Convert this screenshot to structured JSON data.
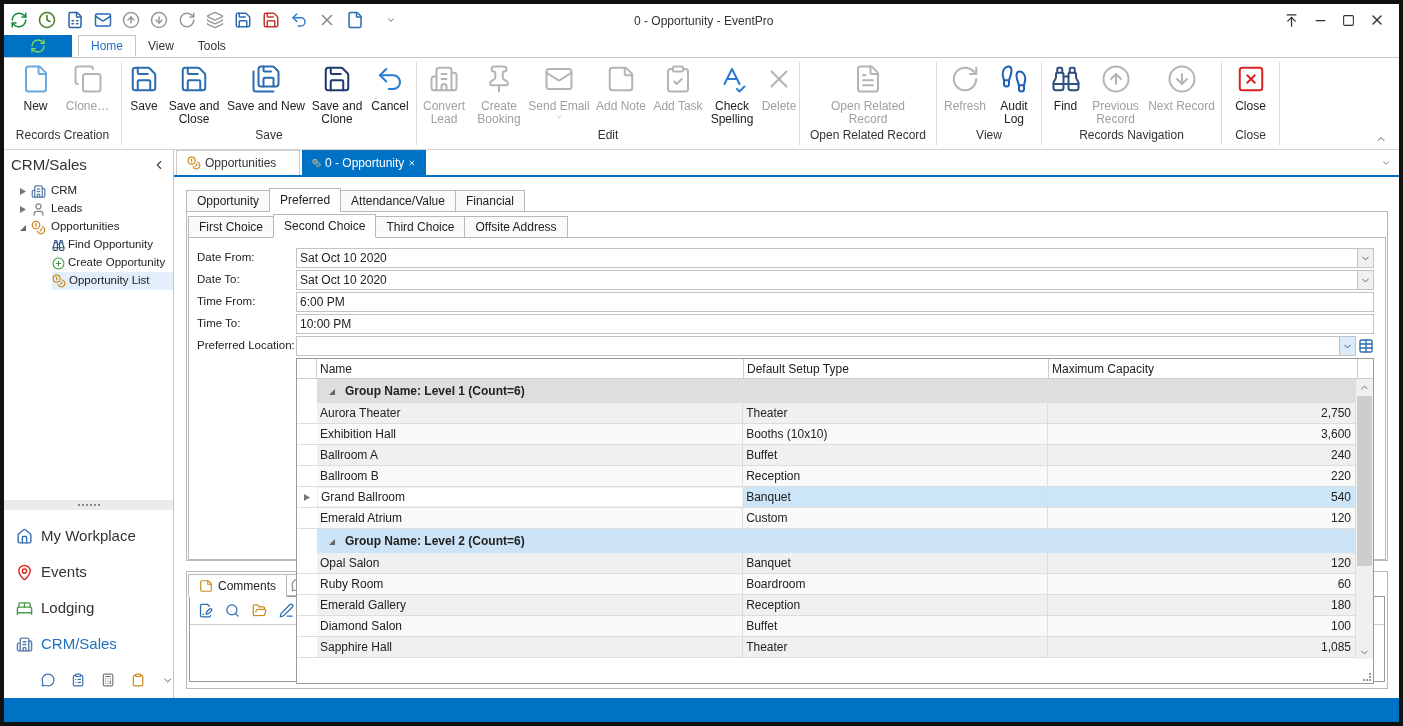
{
  "window": {
    "title": "0 - Opportunity - EventPro"
  },
  "ribbon_tabs": [
    {
      "label": "Home",
      "selected": true
    },
    {
      "label": "View",
      "selected": false
    },
    {
      "label": "Tools",
      "selected": false
    }
  ],
  "ribbon_groups": [
    {
      "label": "Records Creation",
      "buttons": [
        {
          "label": "New",
          "disabled": false,
          "dropdown": false
        },
        {
          "label": "Clone…",
          "disabled": true,
          "dropdown": false
        }
      ]
    },
    {
      "label": "Save",
      "buttons": [
        {
          "label": "Save",
          "disabled": false,
          "dropdown": false
        },
        {
          "label": "Save and Close",
          "disabled": false,
          "dropdown": false
        },
        {
          "label": "Save and New",
          "disabled": false,
          "dropdown": false
        },
        {
          "label": "Save and Clone",
          "disabled": false,
          "dropdown": false
        },
        {
          "label": "Cancel",
          "disabled": false,
          "dropdown": false
        }
      ]
    },
    {
      "label": "Edit",
      "buttons": [
        {
          "label": "Convert Lead",
          "disabled": true,
          "dropdown": false
        },
        {
          "label": "Create Booking",
          "disabled": true,
          "dropdown": false
        },
        {
          "label": "Send Email",
          "disabled": true,
          "dropdown": true
        },
        {
          "label": "Add Note",
          "disabled": true,
          "dropdown": false
        },
        {
          "label": "Add Task",
          "disabled": true,
          "dropdown": false
        },
        {
          "label": "Check Spelling",
          "disabled": false,
          "dropdown": false
        },
        {
          "label": "Delete",
          "disabled": true,
          "dropdown": false
        }
      ]
    },
    {
      "label": "Open Related Record",
      "buttons": [
        {
          "label": "Open Related Record",
          "disabled": true,
          "dropdown": false
        }
      ]
    },
    {
      "label": "View",
      "buttons": [
        {
          "label": "Refresh",
          "disabled": true,
          "dropdown": false
        },
        {
          "label": "Audit Log",
          "disabled": false,
          "dropdown": false
        }
      ]
    },
    {
      "label": "Records Navigation",
      "buttons": [
        {
          "label": "Find",
          "disabled": false,
          "dropdown": false
        },
        {
          "label": "Previous Record",
          "disabled": true,
          "dropdown": false
        },
        {
          "label": "Next Record",
          "disabled": true,
          "dropdown": false
        }
      ]
    },
    {
      "label": "Close",
      "buttons": [
        {
          "label": "Close",
          "disabled": false,
          "dropdown": false
        }
      ]
    }
  ],
  "sidebar": {
    "title": "CRM/Sales",
    "tree": [
      {
        "label": "CRM",
        "expanded": false,
        "selected": false
      },
      {
        "label": "Leads",
        "expanded": false,
        "selected": false
      },
      {
        "label": "Opportunities",
        "expanded": true,
        "selected": false,
        "children": [
          {
            "label": "Find Opportunity",
            "selected": false
          },
          {
            "label": "Create Opportunity",
            "selected": false
          },
          {
            "label": "Opportunity List",
            "selected": true
          }
        ]
      }
    ],
    "nav": [
      {
        "label": "My Workplace",
        "selected": false
      },
      {
        "label": "Events",
        "selected": false
      },
      {
        "label": "Lodging",
        "selected": false
      },
      {
        "label": "CRM/Sales",
        "selected": true
      }
    ]
  },
  "doc_tabs": [
    {
      "label": "Opportunities",
      "selected": false
    },
    {
      "label": "0 - Opportunity",
      "selected": true
    }
  ],
  "form_tabs": [
    {
      "label": "Opportunity",
      "selected": false
    },
    {
      "label": "Preferred",
      "selected": true
    },
    {
      "label": "Attendance/Value",
      "selected": false
    },
    {
      "label": "Financial",
      "selected": false
    }
  ],
  "sub_tabs": [
    {
      "label": "First Choice",
      "selected": false
    },
    {
      "label": "Second Choice",
      "selected": true
    },
    {
      "label": "Third Choice",
      "selected": false
    },
    {
      "label": "Offsite Address",
      "selected": false
    }
  ],
  "fields": [
    {
      "label": "Date From:",
      "value": "Sat Oct 10 2020",
      "kind": "dropdown"
    },
    {
      "label": "Date To:",
      "value": "Sat Oct 10 2020",
      "kind": "dropdown"
    },
    {
      "label": "Time From:",
      "value": "6:00 PM",
      "kind": "text"
    },
    {
      "label": "Time To:",
      "value": "10:00 PM",
      "kind": "text"
    },
    {
      "label": "Preferred Location:",
      "kind": "lookup"
    }
  ],
  "location_grid": {
    "columns": [
      "Name",
      "Default Setup Type",
      "Maximum Capacity"
    ],
    "groups": [
      {
        "label": "Group Name: Level 1 (Count=6)",
        "highlighted": false,
        "rows": [
          {
            "cells": [
              "Aurora Theater",
              "Theater",
              "2,750"
            ],
            "selected": false
          },
          {
            "cells": [
              "Exhibition Hall",
              "Booths (10x10)",
              "3,600"
            ],
            "selected": false
          },
          {
            "cells": [
              "Ballroom A",
              "Buffet",
              "240"
            ],
            "selected": false
          },
          {
            "cells": [
              "Ballroom B",
              "Reception",
              "220"
            ],
            "selected": false
          },
          {
            "cells": [
              "Grand Ballroom",
              "Banquet",
              "540"
            ],
            "selected": true
          },
          {
            "cells": [
              "Emerald Atrium",
              "Custom",
              "120"
            ],
            "selected": false
          }
        ]
      },
      {
        "label": "Group Name: Level 2 (Count=6)",
        "highlighted": true,
        "rows": [
          {
            "cells": [
              "Opal Salon",
              "Banquet",
              "120"
            ],
            "selected": false
          },
          {
            "cells": [
              "Ruby Room",
              "Boardroom",
              "60"
            ],
            "selected": false
          },
          {
            "cells": [
              "Emerald Gallery",
              "Reception",
              "180"
            ],
            "selected": false
          },
          {
            "cells": [
              "Diamond Salon",
              "Buffet",
              "100"
            ],
            "selected": false
          },
          {
            "cells": [
              "Sapphire Hall",
              "Theater",
              "1,085"
            ],
            "selected": false
          }
        ]
      }
    ]
  },
  "comments_tabs": [
    {
      "label": "Comments",
      "selected": true
    }
  ]
}
